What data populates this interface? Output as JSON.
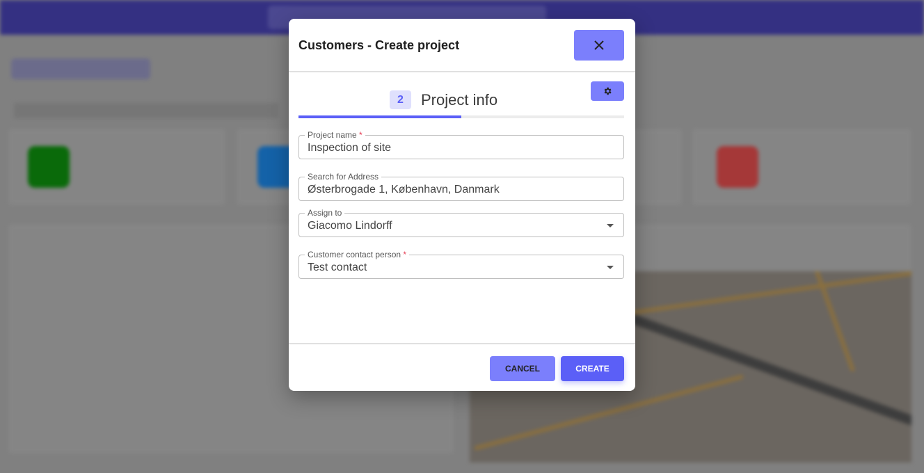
{
  "modal": {
    "title": "Customers - Create project",
    "step": {
      "number": "2",
      "title": "Project info",
      "progress_percent": 50
    },
    "fields": [
      {
        "label": "Project name",
        "required": true,
        "value": "Inspection of site",
        "type": "text"
      },
      {
        "label": "Search for Address",
        "required": false,
        "value": "Østerbrogade 1, København, Danmark",
        "type": "text"
      },
      {
        "label": "Assign to",
        "required": false,
        "value": "Giacomo Lindorff",
        "type": "select"
      },
      {
        "label": "Customer contact person",
        "required": true,
        "value": "Test contact",
        "type": "select"
      }
    ],
    "cancel_label": "CANCEL",
    "create_label": "CREATE"
  },
  "colors": {
    "accent": "#5b5ff7",
    "accent_light": "#7b7ffc",
    "topbar": "#343082",
    "required": "#e53950"
  },
  "icons": {
    "close": "close-icon",
    "settings": "gear-icon",
    "dropdown": "caret-down-icon"
  }
}
